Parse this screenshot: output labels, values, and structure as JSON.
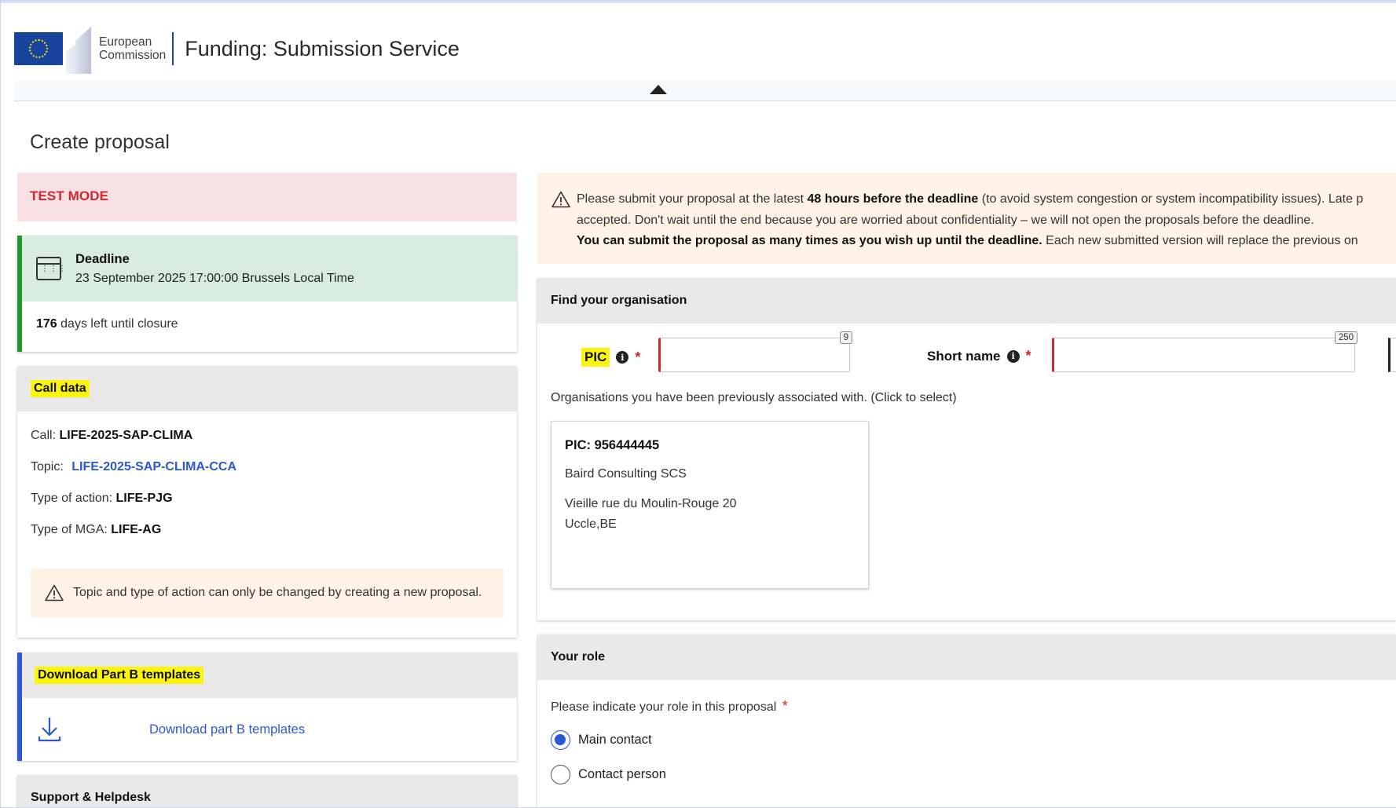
{
  "header": {
    "logo_line1": "European",
    "logo_line2": "Commission",
    "app_title": "Funding: Submission Service"
  },
  "page": {
    "title": "Create proposal"
  },
  "test_mode": {
    "label": "TEST MODE"
  },
  "deadline": {
    "title": "Deadline",
    "date": "23 September 2025 17:00:00 Brussels Local Time",
    "days_left": "176",
    "days_left_suffix": "days left until closure"
  },
  "call_data": {
    "heading": "Call data",
    "call_label": "Call:",
    "call_value": "LIFE-2025-SAP-CLIMA",
    "topic_label": "Topic:",
    "topic_value": "LIFE-2025-SAP-CLIMA-CCA",
    "action_label": "Type of action:",
    "action_value": "LIFE-PJG",
    "mga_label": "Type of MGA:",
    "mga_value": "LIFE-AG",
    "warning": "Topic and type of action can only be changed by creating a new proposal."
  },
  "download": {
    "heading": "Download Part B templates",
    "link": "Download part B templates"
  },
  "support": {
    "heading": "Support & Helpdesk"
  },
  "notice": {
    "line1_a": "Please submit your proposal at the latest ",
    "line1_b": "48 hours before the deadline",
    "line1_c": " (to avoid system congestion or system incompatibility issues). Late p",
    "line2": "accepted. Don't wait until the end because you are worried about confidentiality – we will not open the proposals before the deadline.",
    "line3_a": "You can submit the proposal as many times as you wish up until the deadline.",
    "line3_b": " Each new submitted version will replace the previous on"
  },
  "find_org": {
    "heading": "Find your organisation",
    "pic_label": "PIC",
    "pic_counter": "9",
    "pic_value": "",
    "short_name_label": "Short name",
    "short_name_counter": "250",
    "short_name_value": "",
    "prev_text": "Organisations you have been previously associated with. (Click to select)",
    "org": {
      "pic": "PIC: 956444445",
      "name": "Baird Consulting SCS",
      "street": "Vieille rue du Moulin-Rouge 20",
      "city": "Uccle,BE"
    }
  },
  "role": {
    "heading": "Your role",
    "question": "Please indicate your role in this proposal",
    "options": [
      {
        "label": "Main contact",
        "selected": true
      },
      {
        "label": "Contact person",
        "selected": false
      }
    ]
  },
  "colors": {
    "accent_blue": "#2c57d6",
    "deadline_green": "#23952f",
    "test_mode_red": "#d42630",
    "highlight_yellow": "#fbf40d"
  }
}
